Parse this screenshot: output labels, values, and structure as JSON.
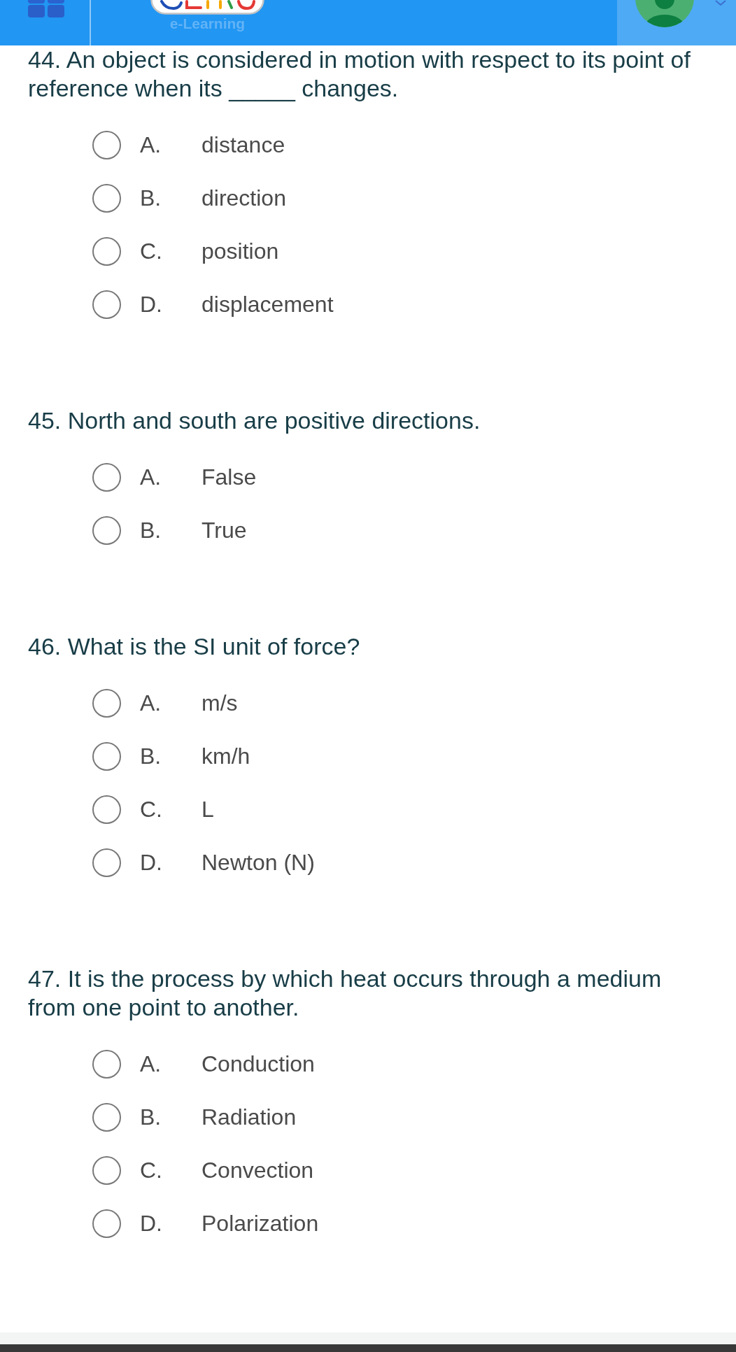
{
  "header": {
    "logo_subtitle": "e-Learning"
  },
  "questions": [
    {
      "text": "44. An object is considered in motion with respect to its point of reference when its _____ changes.",
      "options": [
        {
          "letter": "A.",
          "text": "distance",
          "selected": false
        },
        {
          "letter": "B.",
          "text": "direction",
          "selected": false
        },
        {
          "letter": "C.",
          "text": "position",
          "selected": false
        },
        {
          "letter": "D.",
          "text": "displacement",
          "selected": false
        }
      ]
    },
    {
      "text": "45. North and south are positive directions.",
      "options": [
        {
          "letter": "A.",
          "text": "False",
          "selected": false
        },
        {
          "letter": "B.",
          "text": "True",
          "selected": false
        }
      ]
    },
    {
      "text": "46. What is the SI unit of force?",
      "options": [
        {
          "letter": "A.",
          "text": "m/s",
          "selected": false
        },
        {
          "letter": "B.",
          "text": "km/h",
          "selected": false
        },
        {
          "letter": "C.",
          "text": "L",
          "selected": false
        },
        {
          "letter": "D.",
          "text": "Newton (N)",
          "selected": false
        }
      ]
    },
    {
      "text": "47. It is the process by which heat occurs through a medium from one point to another.",
      "options": [
        {
          "letter": "A.",
          "text": "Conduction",
          "selected": false
        },
        {
          "letter": "B.",
          "text": "Radiation",
          "selected": false
        },
        {
          "letter": "C.",
          "text": "Convection",
          "selected": false
        },
        {
          "letter": "D.",
          "text": "Polarization",
          "selected": false
        }
      ]
    }
  ]
}
